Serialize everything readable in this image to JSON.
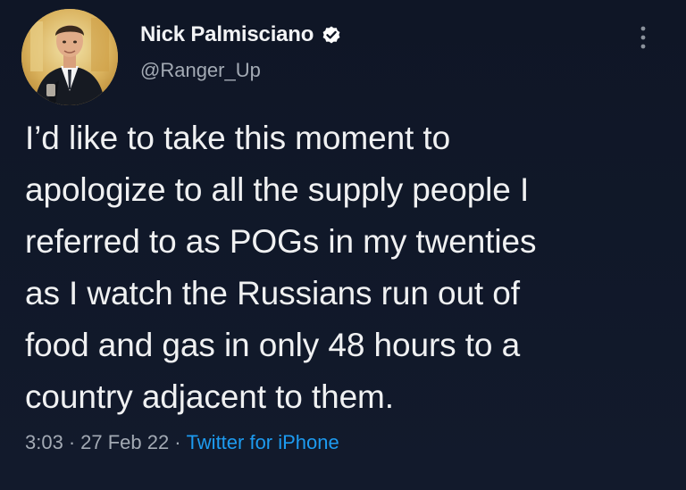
{
  "author": {
    "display_name": "Nick Palmisciano",
    "handle": "@Ranger_Up",
    "verified": true,
    "avatar_icon": "profile-photo"
  },
  "tweet": {
    "text": "I’d like to take this moment to\napologize to all the supply people I\nreferred to as POGs in my twenties\nas I watch the Russians run out of\nfood and gas in only 48 hours to a\ncountry adjacent to them.",
    "time": "3:03",
    "date": "27 Feb 22",
    "separator": "·",
    "source": "Twitter for iPhone"
  },
  "icons": {
    "verified": "verified-badge-icon",
    "more": "more-options-icon"
  },
  "colors": {
    "background": "#111827",
    "text": "#e7e9ea",
    "secondary_text": "#a3aab4",
    "link": "#1d9bf0",
    "verified_badge": "#ffffff"
  }
}
